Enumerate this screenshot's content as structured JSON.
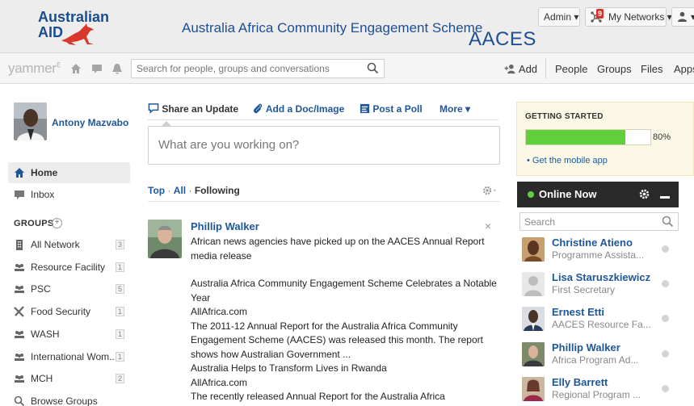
{
  "banner": {
    "logo_line1": "Australian",
    "logo_line2": "AID",
    "title": "Australia Africa Community Engagement Scheme",
    "acronym": "AACES",
    "admin_label": "Admin ▾",
    "networks_label": "My Networks ▾",
    "networks_badge": "9",
    "user_caret": "▾"
  },
  "nav": {
    "logo": "yammer",
    "logo_mark": "ℇ",
    "search_placeholder": "Search for people, groups and conversations",
    "add_label": "Add",
    "people_label": "People",
    "groups_label": "Groups",
    "files_label": "Files",
    "apps_label": "Apps"
  },
  "sidebar": {
    "user_name": "Antony Mazvabo",
    "home_label": "Home",
    "inbox_label": "Inbox",
    "groups_header": "GROUPS",
    "groups_add": "+",
    "groups": [
      {
        "label": "All Network",
        "count": "3",
        "icon": "building-icon"
      },
      {
        "label": "Resource Facility",
        "count": "1",
        "icon": "group-icon"
      },
      {
        "label": "PSC",
        "count": "5",
        "icon": "group-icon"
      },
      {
        "label": "Food Security",
        "count": "1",
        "icon": "tools-icon"
      },
      {
        "label": "WASH",
        "count": "1",
        "icon": "group-icon"
      },
      {
        "label": "International Wom...",
        "count": "1",
        "icon": "group-icon"
      },
      {
        "label": "MCH",
        "count": "2",
        "icon": "group-icon"
      }
    ],
    "browse_groups": "Browse Groups"
  },
  "publisher": {
    "share_update": "Share an Update",
    "add_doc": "Add a Doc/Image",
    "post_poll": "Post a Poll",
    "more": "More ▾",
    "composer_placeholder": "What are you working on?"
  },
  "feed": {
    "filter_top": "Top",
    "filter_all": "All",
    "filter_following": "Following",
    "separator": "·",
    "post": {
      "author": "Phillip Walker",
      "close": "×",
      "lines": [
        "African news agencies have picked up on the AACES Annual Report media release",
        "",
        "Australia Africa Community Engagement Scheme Celebrates a Notable Year",
        "AllAfrica.com",
        "The 2011-12 Annual Report for the Australia Africa Community Engagement Scheme (AACES) was released this month. The report shows how Australian Government ...",
        "Australia Helps to Transform Lives in Rwanda",
        "AllAfrica.com",
        "The recently released Annual Report for the Australia Africa"
      ]
    }
  },
  "getting_started": {
    "title": "GETTING STARTED",
    "progress": 0.8,
    "progress_label": "80%",
    "link": "Get the mobile app",
    "bullet": "•"
  },
  "online_now": {
    "title": "Online Now",
    "search_placeholder": "Search",
    "people": [
      {
        "name": "Christine Atieno",
        "role": "Programme Assista..."
      },
      {
        "name": "Lisa Staruszkiewicz",
        "role": "First Secretary"
      },
      {
        "name": "Ernest Etti",
        "role": "AACES Resource Fa..."
      },
      {
        "name": "Phillip Walker",
        "role": "Africa Program Ad..."
      },
      {
        "name": "Elly Barrett",
        "role": "Regional Program ..."
      }
    ]
  },
  "colors": {
    "link": "#1e5799",
    "progress_fill": "#5fcf3b",
    "banner_blue": "#1f4e91",
    "online_header": "#2a2a2a"
  }
}
